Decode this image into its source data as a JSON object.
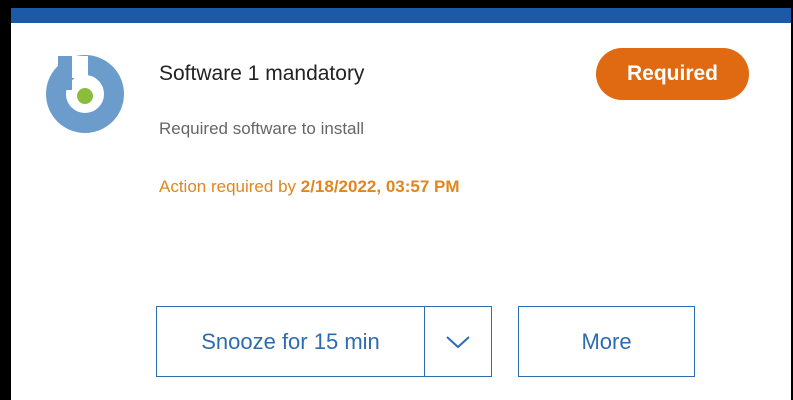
{
  "notification": {
    "title": "Software 1 mandatory",
    "badge": "Required",
    "subtitle": "Required software to install",
    "action_prefix": "Action required by ",
    "action_deadline": "2/18/2022, 03:57 PM"
  },
  "buttons": {
    "snooze_label": "Snooze for 15 min",
    "more_label": "More"
  },
  "icons": {
    "logo": "app-logo-icon",
    "dropdown": "chevron-down-icon"
  },
  "colors": {
    "top_bar": "#1a5aa6",
    "badge_bg": "#df6a12",
    "action_text": "#e0861d",
    "button_accent": "#2e6cb0",
    "logo_ring": "#6c9ccc",
    "logo_dot": "#8bbd3c"
  }
}
